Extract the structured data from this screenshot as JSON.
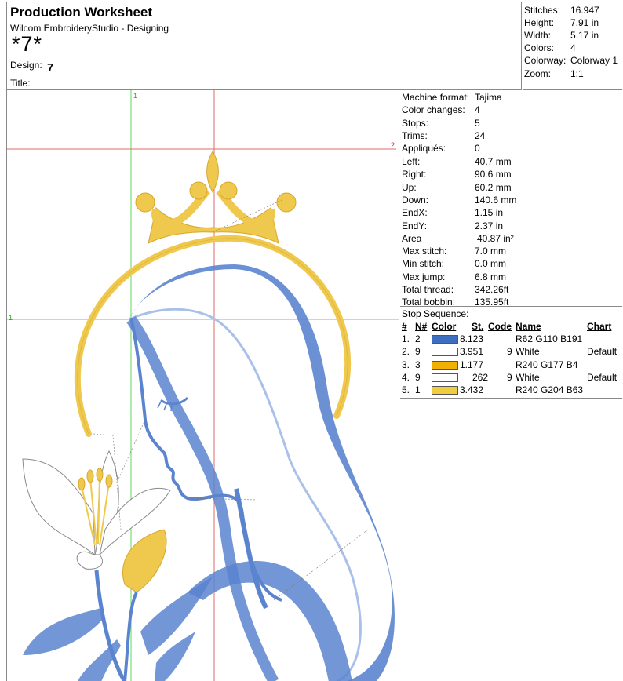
{
  "header": {
    "title": "Production Worksheet",
    "app": "Wilcom EmbroideryStudio - Designing",
    "big_name": "*7*",
    "design_label": "Design:",
    "design_value": "7",
    "title_label": "Title:"
  },
  "header_stats": [
    {
      "label": "Stitches:",
      "value": "16.947"
    },
    {
      "label": "Height:",
      "value": "7.91 in"
    },
    {
      "label": "Width:",
      "value": "5.17 in"
    },
    {
      "label": "Colors:",
      "value": "4"
    },
    {
      "label": "Colorway:",
      "value": "Colorway 1"
    },
    {
      "label": "Zoom:",
      "value": "1:1"
    }
  ],
  "machine_info": [
    {
      "label": "Machine format:",
      "value": "Tajima"
    },
    {
      "label": "Color changes:",
      "value": "4"
    },
    {
      "label": "Stops:",
      "value": "5"
    },
    {
      "label": "Trims:",
      "value": "24"
    },
    {
      "label": "Appliqués:",
      "value": "0"
    },
    {
      "label": "Left:",
      "value": "40.7 mm"
    },
    {
      "label": "Right:",
      "value": "90.6 mm"
    },
    {
      "label": "Up:",
      "value": "60.2 mm"
    },
    {
      "label": "Down:",
      "value": "140.6 mm"
    },
    {
      "label": "EndX:",
      "value": "1.15 in"
    },
    {
      "label": "EndY:",
      "value": "2.37 in"
    },
    {
      "label": "Area",
      "value": "40.87 in²"
    },
    {
      "label": "Max stitch:",
      "value": "7.0 mm"
    },
    {
      "label": "Min stitch:",
      "value": "0.0 mm"
    },
    {
      "label": "Max jump:",
      "value": "6.8 mm"
    },
    {
      "label": "Total thread:",
      "value": "342.26ft"
    },
    {
      "label": "Total bobbin:",
      "value": "135.95ft"
    }
  ],
  "stop_sequence": {
    "title": "Stop Sequence:",
    "columns": {
      "num": "#",
      "needle": "N#",
      "color": "Color",
      "stitches": "St.",
      "code": "Code",
      "name": "Name",
      "chart": "Chart"
    },
    "rows": [
      {
        "num": "1.",
        "needle": "2",
        "swatch": "#3e6ebf",
        "stitches": "8.123",
        "code": "",
        "name": "R62 G110 B191",
        "chart": ""
      },
      {
        "num": "2.",
        "needle": "9",
        "swatch": "#ffffff",
        "stitches": "3.951",
        "code": "9",
        "name": "White",
        "chart": "Default"
      },
      {
        "num": "3.",
        "needle": "3",
        "swatch": "#f0b104",
        "stitches": "1.177",
        "code": "",
        "name": "R240 G177 B4",
        "chart": ""
      },
      {
        "num": "4.",
        "needle": "9",
        "swatch": "#ffffff",
        "stitches": "262",
        "code": "9",
        "name": "White",
        "chart": "Default"
      },
      {
        "num": "5.",
        "needle": "1",
        "swatch": "#f0cc3f",
        "stitches": "3.432",
        "code": "",
        "name": "R240 G204 B63",
        "chart": ""
      }
    ]
  },
  "canvas": {
    "guide_v_label": "1",
    "guide_h_label": "1",
    "guide_red_label": "2"
  },
  "colors": {
    "blue": "#5b84cf",
    "blue_light": "#a9c1ea",
    "gold": "#efc94d",
    "gold_dark": "#d8a62a",
    "guide_green": "#5ed85e",
    "guide_red": "#e26a6a"
  }
}
